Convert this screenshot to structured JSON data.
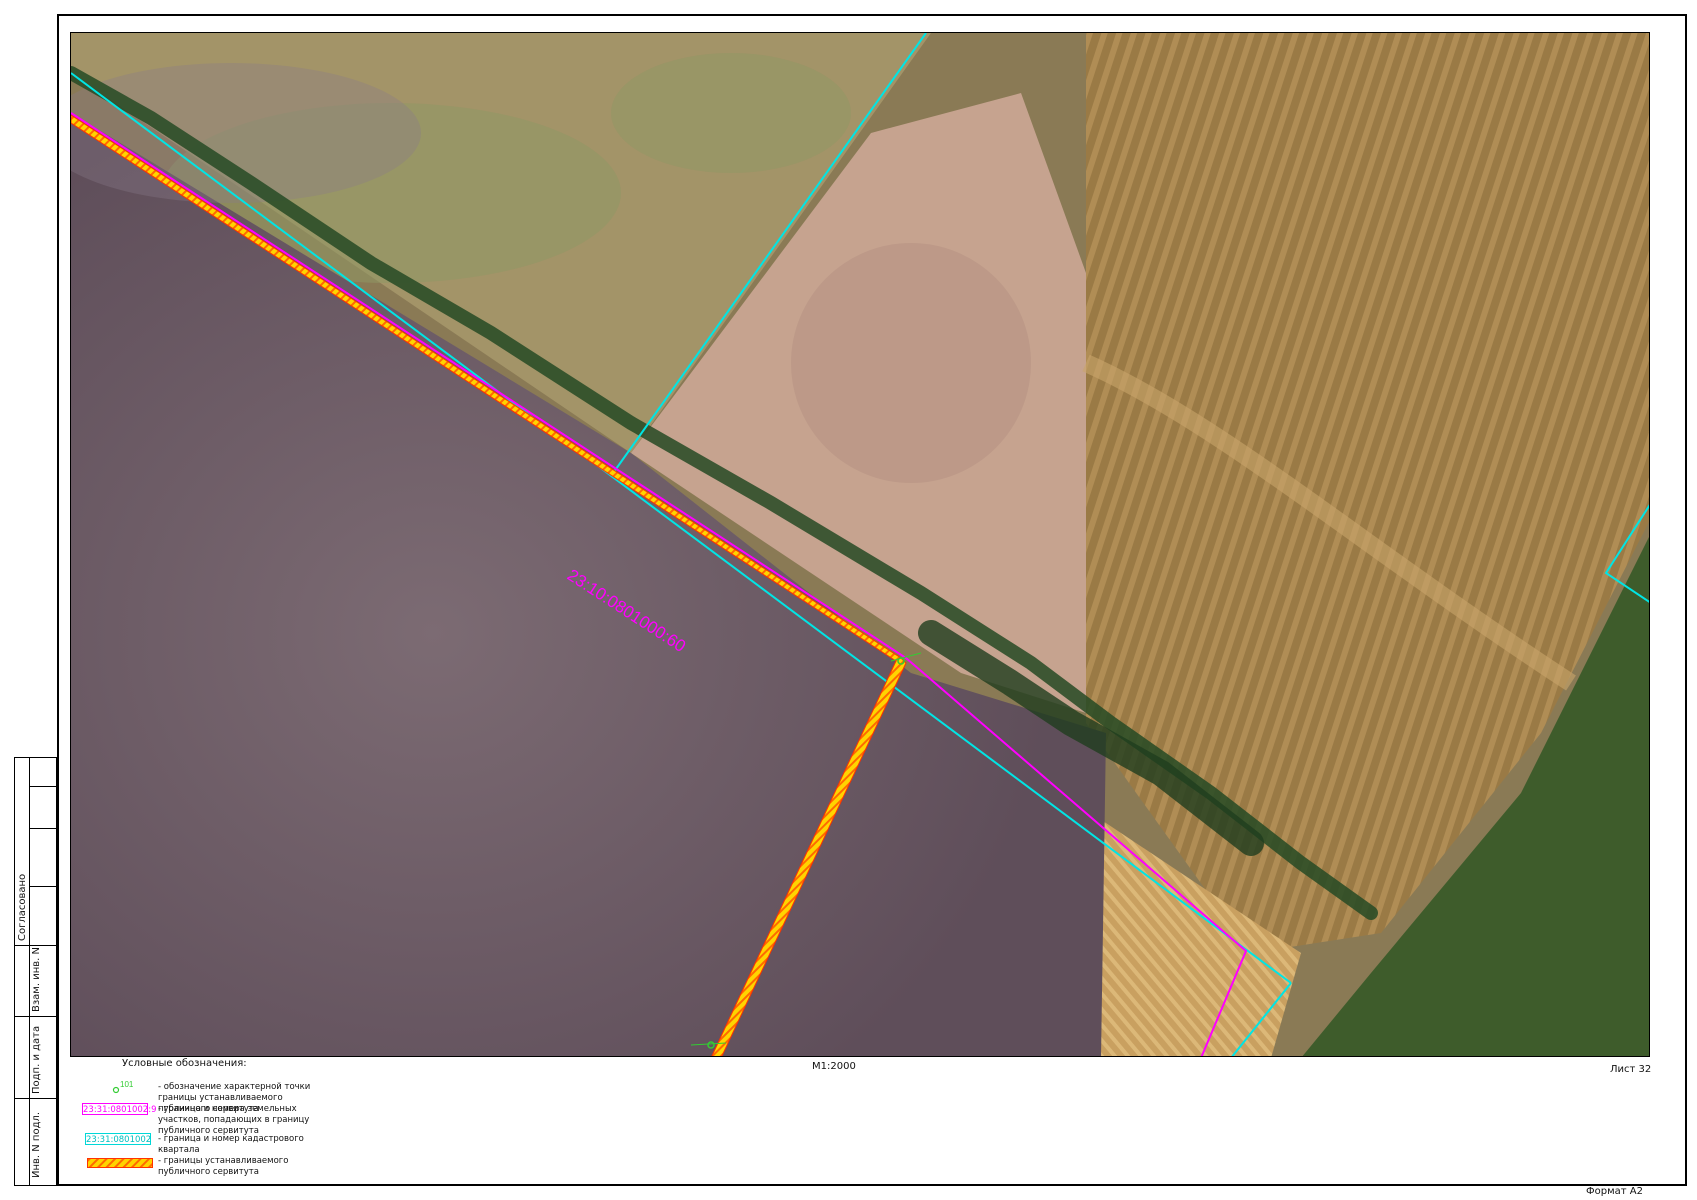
{
  "map": {
    "parcel_label": "23:10:0801000:60",
    "colors": {
      "parcel_boundary": "#ff00ff",
      "quarter_boundary": "#00e5e5",
      "servitude_fill": "#ffd400",
      "servitude_border": "#ff3300",
      "point_marker": "#33cc33"
    }
  },
  "stamp": {
    "agreed": "Согласовано",
    "replaced_inv": "Взам. инв. N",
    "sign_date": "Подп. и дата",
    "inv_orig": "Инв. N подл."
  },
  "legend": {
    "title": "Условные обозначения:",
    "point_number": "101",
    "point_desc": "- обозначение характерной точки границы устанавливаемого публичного сервитута",
    "parcel_sample": "23:31:0801002:9",
    "parcel_desc": "- граница и номера земельных участков, попадающих в границу публичного сервитута",
    "quarter_sample": "23:31:0801002",
    "quarter_desc": "- граница и номер кадастрового квартала",
    "servitude_desc": "- границы устанавливаемого публичного сервитута"
  },
  "scale": "М1:2000",
  "sheet": "Лист 32",
  "format": "Формат А2"
}
